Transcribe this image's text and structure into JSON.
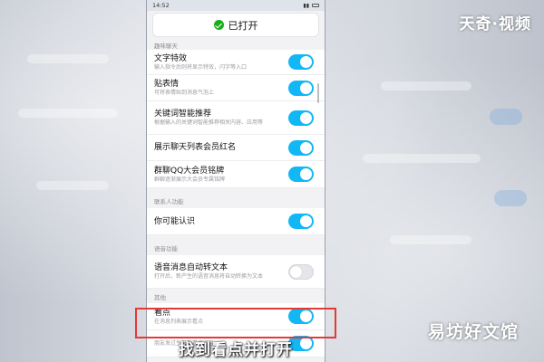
{
  "status_bar": {
    "time": "14:52"
  },
  "top_button": {
    "label": "已打开"
  },
  "watermarks": {
    "top": "天奇·视频",
    "bottom": "易坊好文馆"
  },
  "subtitle": "找到看点并打开",
  "sections": [
    {
      "header": "趣味聊天",
      "items": [
        {
          "title": "文字特效",
          "desc": "输入指令后则将显示特效，闪字等入口",
          "on": true
        },
        {
          "title": "贴表情",
          "desc": "可将表情贴到消息气泡上",
          "on": true
        },
        {
          "title": "关键词智能推荐",
          "desc": "根据输入的关键词智能推荐相关内容、应用等",
          "on": true
        },
        {
          "title": "展示聊天列表会员红名",
          "desc": "",
          "on": true
        },
        {
          "title": "群聊QQ大会员铭牌",
          "desc": "群聊逐渐展示大会员专属铭牌",
          "on": true
        }
      ]
    },
    {
      "header": "联系人功能",
      "items": [
        {
          "title": "你可能认识",
          "desc": "",
          "on": true
        }
      ]
    },
    {
      "header": "语音功能",
      "items": [
        {
          "title": "语音消息自动转文本",
          "desc": "打开后，新产生的语音消息将自动转换为文本",
          "on": false
        }
      ]
    },
    {
      "header": "其他",
      "items": [
        {
          "title": "看点",
          "desc": "在消息列表展示看点",
          "on": true
        },
        {
          "title": "",
          "desc": "朋友发过生日的看点消息",
          "on": true
        }
      ]
    }
  ],
  "colors": {
    "toggle_on": "#12b7f5",
    "toggle_off": "#e6e6ea",
    "highlight": "#e53935",
    "check": "#1aad19"
  }
}
